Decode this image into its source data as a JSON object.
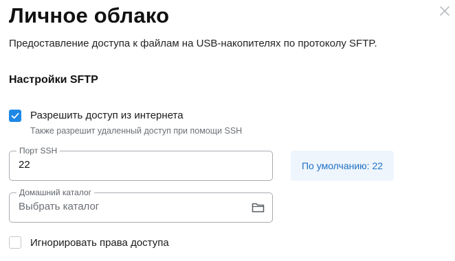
{
  "dialog": {
    "title": "Личное облако",
    "description": "Предоставление доступа к файлам на USB-накопителях по протоколу SFTP."
  },
  "sftp": {
    "section_title": "Настройки SFTP",
    "internet_access": {
      "label": "Разрешить доступ из интернета",
      "hint": "Также разрешит удаленный доступ при помощи SSH",
      "checked": true
    },
    "ssh_port": {
      "label": "Порт SSH",
      "value": "22",
      "default_text": "По умолчанию: 22"
    },
    "home_dir": {
      "label": "Домашний каталог",
      "placeholder": "Выбрать каталог"
    },
    "ignore_permissions": {
      "label": "Игнорировать права доступа",
      "checked": false
    }
  },
  "icons": {
    "close": "close-icon",
    "folder": "folder-icon",
    "check": "checkmark-icon"
  },
  "colors": {
    "accent": "#1e88e5",
    "chip_background": "#eef5fc",
    "chip_text": "#1e6fc4"
  }
}
